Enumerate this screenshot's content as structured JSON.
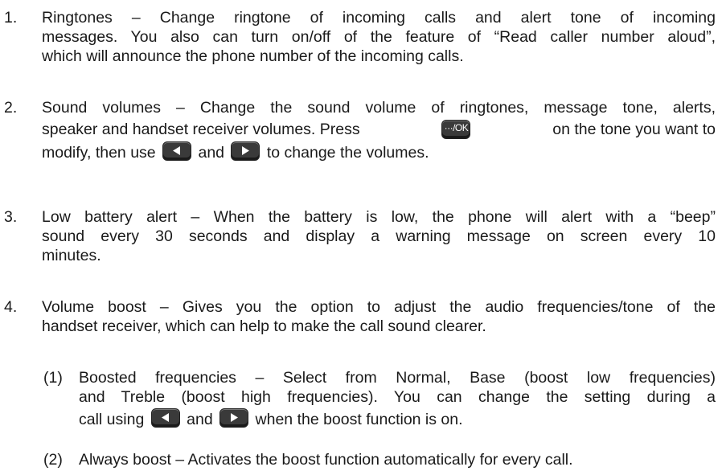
{
  "items": [
    {
      "number": "1.",
      "lines": [
        "Ringtones – Change ringtone of incoming calls and alert tone of incoming",
        "messages. You also can turn on/off of the feature of “Read caller number aloud”,",
        "which will announce the phone number of the incoming calls."
      ]
    },
    {
      "number": "2.",
      "line1": "Sound volumes – Change the sound volume of ringtones, message tone, alerts,",
      "line2_a": "speaker and handset receiver volumes. Press",
      "line2_b": "on the tone you want to",
      "line3_a": "modify, then use",
      "line3_b": "and",
      "line3_c": "to change the volumes."
    },
    {
      "number": "3.",
      "lines": [
        "Low battery alert – When the battery is low, the phone will alert with a “beep”",
        "sound every 30 seconds and display a warning message on screen every 10",
        "minutes."
      ]
    },
    {
      "number": "4.",
      "lines": [
        "Volume boost – Gives you the option to adjust the audio frequencies/tone of the",
        "handset receiver, which can help to make the call sound clearer."
      ]
    }
  ],
  "subitems": [
    {
      "number": "(1)",
      "line1": "Boosted frequencies – Select from Normal, Base (boost low frequencies)",
      "line2": "and Treble (boost high frequencies). You can change the setting during a",
      "line3_a": "call using",
      "line3_b": "and",
      "line3_c": "when the boost function is on."
    },
    {
      "number": "(2)",
      "line1": "Always boost – Activates the boost function automatically for every call."
    }
  ],
  "keys": {
    "ok_label": "···/OK",
    "left_icon": "left-arrow-key-icon",
    "right_icon": "right-arrow-key-icon"
  }
}
